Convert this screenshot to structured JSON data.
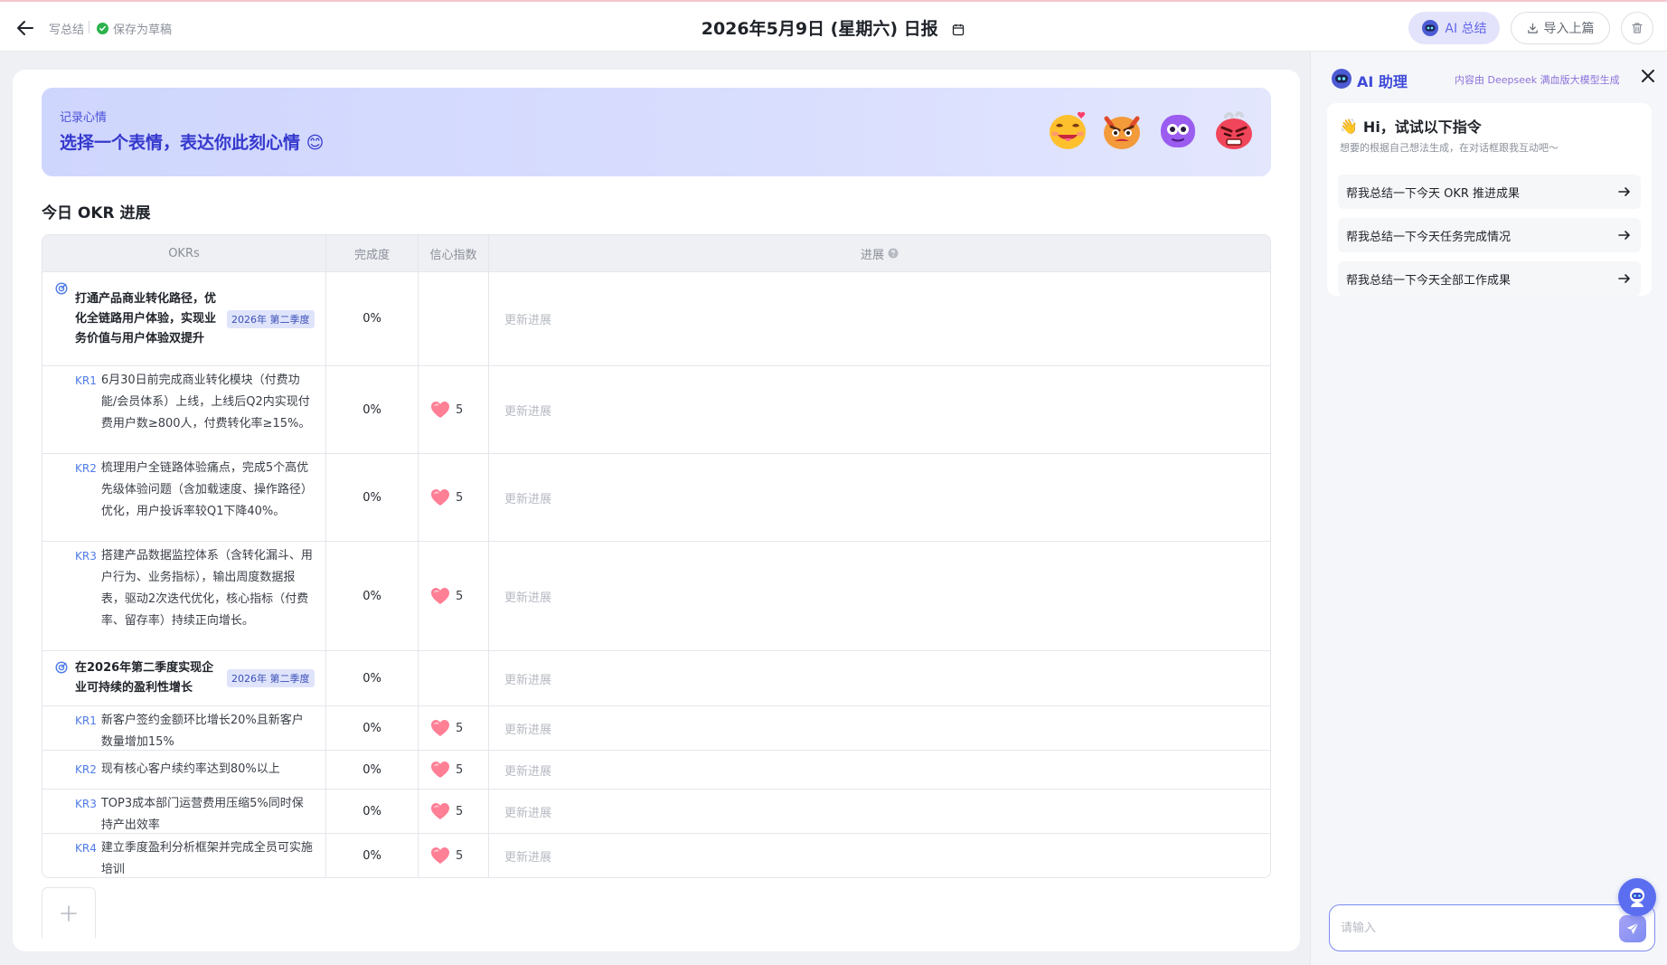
{
  "header": {
    "breadcrumb": "写总结",
    "draft_status": "保存为草稿",
    "title": "2026年5月9日 (星期六) 日报",
    "ai_summary_btn": "AI 总结",
    "import_btn": "导入上篇"
  },
  "mood": {
    "label": "记录心情",
    "prompt": "选择一个表情，表达你此刻心情 😊",
    "emojis": [
      "loved-emoji-icon",
      "angry-emoji-icon",
      "purple-monster-emoji-icon",
      "furious-emoji-icon"
    ]
  },
  "okr": {
    "section_title": "今日 OKR 进展",
    "columns": [
      "OKRs",
      "完成度",
      "信心指数",
      "进展"
    ],
    "update_placeholder": "更新进展",
    "objectives": [
      {
        "text": "打通产品商业转化路径，优化全链路用户体验，实现业务价值与用户体验双提升",
        "tag": "2026年 第二季度",
        "completion": "0%",
        "krs": [
          {
            "tag": "KR1",
            "text": "6月30日前完成商业转化模块（付费功能/会员体系）上线，上线后Q2内实现付费用户数≥800人，付费转化率≥15%。",
            "completion": "0%",
            "confidence": "5"
          },
          {
            "tag": "KR2",
            "text": "梳理用户全链路体验痛点，完成5个高优先级体验问题（含加载速度、操作路径）优化，用户投诉率较Q1下降40%。",
            "completion": "0%",
            "confidence": "5"
          },
          {
            "tag": "KR3",
            "text": "搭建产品数据监控体系（含转化漏斗、用户行为、业务指标），输出周度数据报表，驱动2次迭代优化，核心指标（付费率、留存率）持续正向增长。",
            "completion": "0%",
            "confidence": "5"
          }
        ]
      },
      {
        "text": "在2026年第二季度实现企业可持续的盈利性增长",
        "tag": "2026年 第二季度",
        "completion": "0%",
        "krs": [
          {
            "tag": "KR1",
            "text": "新客户签约金额环比增长20%且新客户数量增加15%",
            "completion": "0%",
            "confidence": "5"
          },
          {
            "tag": "KR2",
            "text": "现有核心客户续约率达到80%以上",
            "completion": "0%",
            "confidence": "5"
          },
          {
            "tag": "KR3",
            "text": "TOP3成本部门运营费用压缩5%同时保持产出效率",
            "completion": "0%",
            "confidence": "5"
          },
          {
            "tag": "KR4",
            "text": "建立季度盈利分析框架并完成全员可实施培训",
            "completion": "0%",
            "confidence": "5"
          }
        ]
      }
    ]
  },
  "ai_panel": {
    "title": "AI 助理",
    "note": "内容由 Deepseek 满血版大模型生成",
    "greeting": "Hi，试试以下指令",
    "greeting_emoji": "👋",
    "subtext": "想要的根据自己想法生成，在对话框跟我互动吧～",
    "suggestions": [
      "帮我总结一下今天 OKR 推进成果",
      "帮我总结一下今天任务完成情况",
      "帮我总结一下今天全部工作成果"
    ],
    "input_placeholder": "请输入"
  },
  "colors": {
    "accent": "#5b6ef0",
    "banner": "#d4dafd",
    "kr_tag": "#4e7be6"
  }
}
